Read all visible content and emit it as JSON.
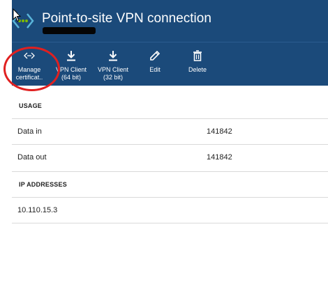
{
  "header": {
    "title": "Point-to-site VPN connection"
  },
  "toolbar": {
    "items": [
      {
        "label": "Manage\ncertificat..",
        "icon": "connection-icon"
      },
      {
        "label": "VPN Client\n(64 bit)",
        "icon": "download-icon"
      },
      {
        "label": "VPN Client\n(32 bit)",
        "icon": "download-icon"
      },
      {
        "label": "Edit",
        "icon": "pencil-icon"
      },
      {
        "label": "Delete",
        "icon": "trash-icon"
      }
    ]
  },
  "usage": {
    "heading": "USAGE",
    "rows": [
      {
        "label": "Data in",
        "value": "141842"
      },
      {
        "label": "Data out",
        "value": "141842"
      }
    ]
  },
  "ip": {
    "heading": "IP ADDRESSES",
    "address": "10.110.15.3"
  },
  "colors": {
    "header_bg": "#1b4a7a",
    "highlight_circle": "#e02020"
  }
}
